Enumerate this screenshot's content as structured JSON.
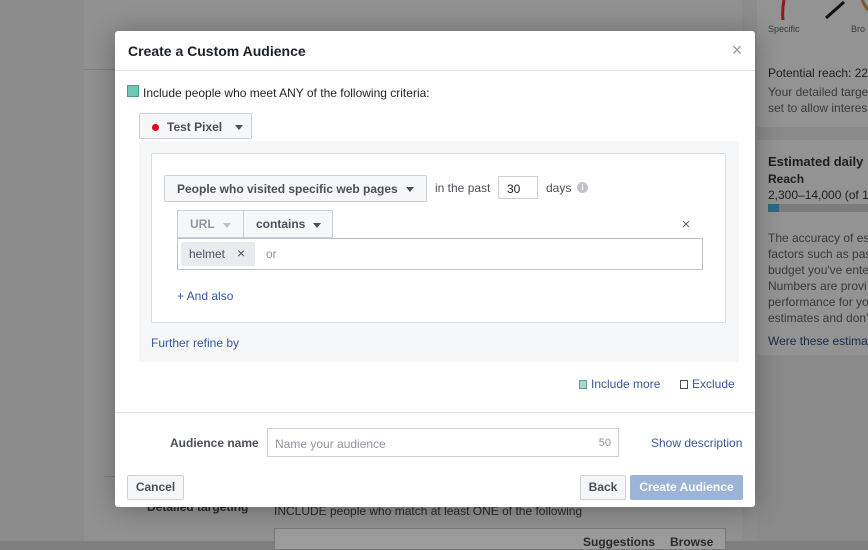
{
  "background": {
    "dial_labels": [
      "Specific",
      "Bro"
    ],
    "potential_reach": "Potential reach: 22",
    "targeting_note": [
      "Your detailed targe",
      "set to allow interes"
    ],
    "estimated_daily": "Estimated daily",
    "reach_label": "Reach",
    "reach_value": "2,300–14,000 (of 1",
    "accuracy_lines": [
      "The accuracy of es",
      "factors such as pas",
      "budget you've ente",
      "Numbers are provi",
      "performance for yo",
      "estimates and don'"
    ],
    "were_these": "Were these estima",
    "detailed_targeting": "Detailed targeting",
    "include_people": "INCLUDE people who match at least ONE of the following",
    "suggestions": "Suggestions",
    "browse": "Browse"
  },
  "modal": {
    "title": "Create a Custom Audience",
    "close_symbol": "×",
    "criteria_label": "Include people who meet ANY of the following criteria:",
    "pixel": {
      "label": "Test Pixel",
      "status_color": "#e0001b"
    },
    "rule": {
      "visit_option": "People who visited specific web pages",
      "in_the_past": "in the past",
      "days_value": "30",
      "days_label": "days",
      "info_symbol": "i",
      "field_option": "URL",
      "operator_option": "contains",
      "remove_symbol": "×",
      "tokens": [
        {
          "label": "helmet",
          "remove_symbol": "×"
        }
      ],
      "token_input_placeholder": "or",
      "and_also": "+ And also"
    },
    "further_refine": "Further refine by",
    "include_more": "Include more",
    "exclude": "Exclude",
    "audience_name": {
      "label": "Audience name",
      "placeholder": "Name your audience",
      "char_limit": "50",
      "show_description": "Show description"
    },
    "buttons": {
      "cancel": "Cancel",
      "back": "Back",
      "create": "Create Audience"
    },
    "colors": {
      "accent_link": "#365899",
      "create_disabled": "#9cb4d8",
      "check": "#71c7b6"
    }
  }
}
